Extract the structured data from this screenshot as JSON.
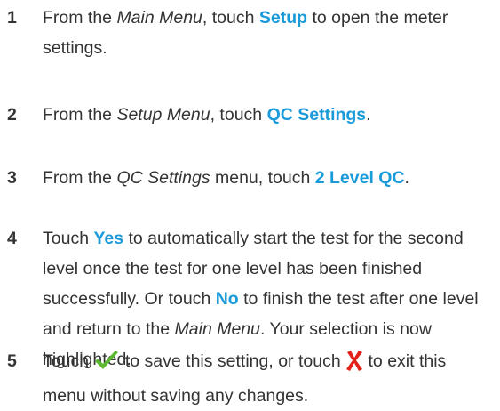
{
  "steps": [
    {
      "number": "1",
      "p1": "From the ",
      "menu": "Main Menu",
      "p2": ", touch ",
      "kw": "Setup",
      "p3": " to open the meter settings."
    },
    {
      "number": "2",
      "p1": "From the ",
      "menu": "Setup Menu",
      "p2": ", touch ",
      "kw": "QC Settings",
      "p3": "."
    },
    {
      "number": "3",
      "p1": "From the ",
      "menu": "QC Settings",
      "p2": " menu, touch ",
      "kw": "2 Level QC",
      "p3": "."
    },
    {
      "number": "4",
      "p1": "Touch ",
      "kw_yes": "Yes",
      "p2": " to automatically start the test for the second level once the test for one level has been finished successfully. Or touch ",
      "kw_no": "No",
      "p3": " to finish the test after one level and return to the ",
      "menu": "Main Menu",
      "p4": ". Your selection is now highlighted."
    },
    {
      "number": "5",
      "p1": "Touch ",
      "icon_save": "checkmark-icon",
      "p2": " to save this setting, or touch ",
      "icon_exit": "cross-icon",
      "p3": " to exit this menu without saving any changes."
    }
  ],
  "colors": {
    "text": "#333333",
    "keyword": "#1a9ad9",
    "checkmark": "#5cb82e",
    "cross": "#e32119"
  }
}
